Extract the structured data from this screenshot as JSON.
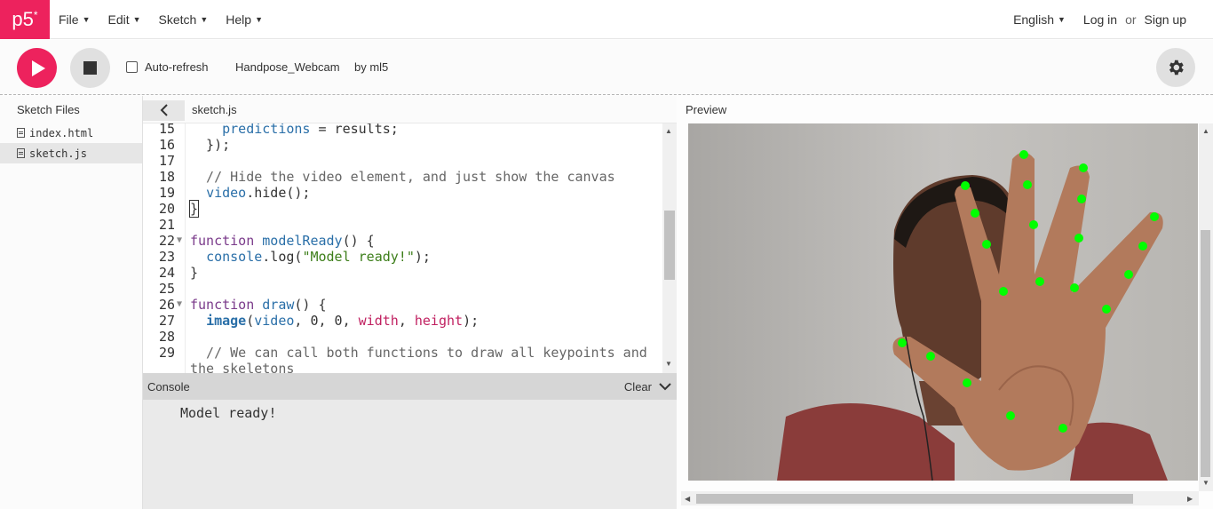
{
  "nav": {
    "logo": "p5",
    "logo_mark": "*",
    "menu": [
      {
        "label": "File"
      },
      {
        "label": "Edit"
      },
      {
        "label": "Sketch"
      },
      {
        "label": "Help"
      }
    ],
    "language": "English",
    "login": "Log in",
    "or": "or",
    "signup": "Sign up"
  },
  "toolbar": {
    "auto_refresh_label": "Auto-refresh",
    "auto_refresh_checked": false,
    "project_name": "Handpose_Webcam",
    "author": "by ml5"
  },
  "sidebar": {
    "title": "Sketch Files",
    "files": [
      {
        "name": "index.html",
        "active": false
      },
      {
        "name": "sketch.js",
        "active": true
      }
    ]
  },
  "editor": {
    "tab": "sketch.js",
    "lines": [
      {
        "n": "15",
        "text": "    predictions = results;"
      },
      {
        "n": "16",
        "text": "  });"
      },
      {
        "n": "17",
        "text": ""
      },
      {
        "n": "18",
        "text": "  // Hide the video element, and just show the canvas"
      },
      {
        "n": "19",
        "text": "  video.hide();"
      },
      {
        "n": "20",
        "text": "}"
      },
      {
        "n": "21",
        "text": ""
      },
      {
        "n": "22",
        "text": "function modelReady() {"
      },
      {
        "n": "23",
        "text": "  console.log(\"Model ready!\");"
      },
      {
        "n": "24",
        "text": "}"
      },
      {
        "n": "25",
        "text": ""
      },
      {
        "n": "26",
        "text": "function draw() {"
      },
      {
        "n": "27",
        "text": "  image(video, 0, 0, width, height);"
      },
      {
        "n": "28",
        "text": ""
      },
      {
        "n": "29",
        "text": "  // We can call both functions to draw all keypoints and"
      },
      {
        "n": "",
        "text": "the skeletons"
      }
    ]
  },
  "console": {
    "title": "Console",
    "clear": "Clear",
    "message": "Model ready!"
  },
  "preview": {
    "title": "Preview",
    "keypoint_color": "#00ff00"
  },
  "colors": {
    "accent": "#ed225d"
  }
}
